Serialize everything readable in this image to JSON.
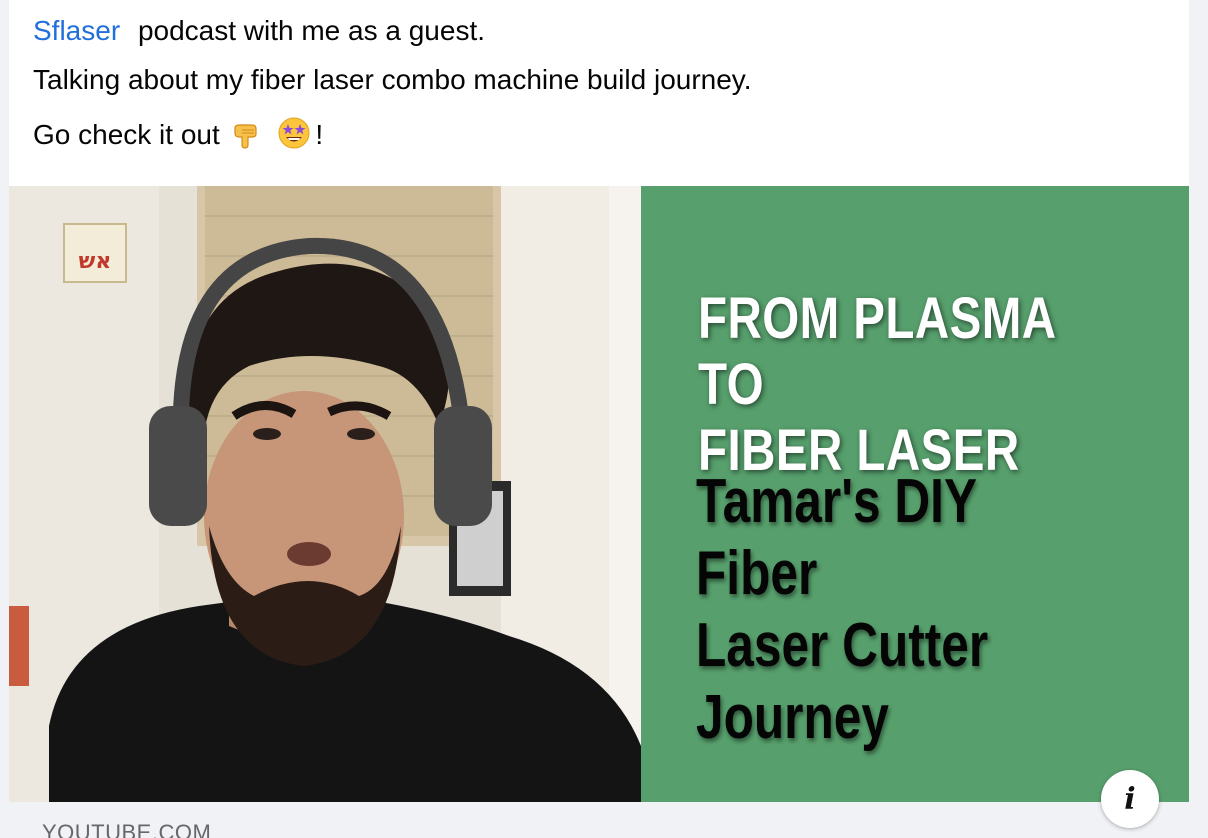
{
  "post": {
    "mention": "Sflaser",
    "line1_rest": "podcast with me as a guest.",
    "line2": "Talking about my fiber laser combo machine build journey.",
    "line3_prefix": "Go check it out",
    "line3_suffix": "!",
    "emojis": [
      "backhand-index-pointing-down-icon",
      "star-struck-icon"
    ]
  },
  "thumbnail": {
    "headline_white": "FROM PLASMA TO\nFIBER LASER",
    "headline_black": "Tamar's DIY Fiber\nLaser Cutter\nJourney",
    "sign_text": "אש",
    "panel_color": "#57a06d"
  },
  "link": {
    "domain": "YOUTUBE.COM",
    "info_label": "i"
  }
}
